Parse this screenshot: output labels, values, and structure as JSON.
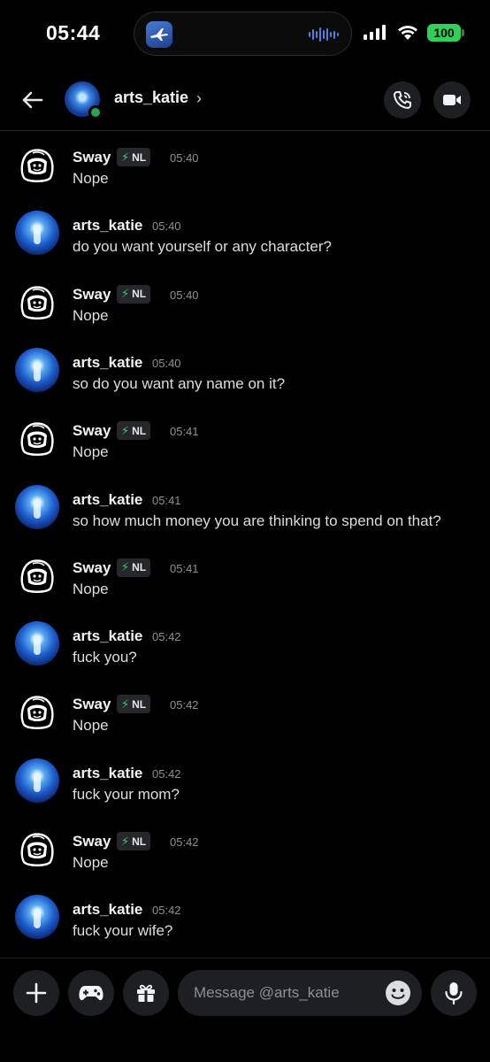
{
  "status_bar": {
    "time": "05:44",
    "battery": "100",
    "icons": [
      "airplane-app-icon",
      "audio-wave-icon",
      "signal-icon",
      "wifi-icon",
      "battery-icon"
    ]
  },
  "header": {
    "name": "arts_katie",
    "chevron": "›",
    "online_color": "#23a55a",
    "icons": [
      "back-arrow-icon",
      "voice-call-icon",
      "video-call-icon"
    ]
  },
  "messages": [
    {
      "author": "Sway",
      "tag": "NL",
      "time": "05:40",
      "text": "Nope",
      "avatar": "sway"
    },
    {
      "author": "arts_katie",
      "tag": "",
      "time": "05:40",
      "text": "do you want yourself or any character?",
      "avatar": "katie"
    },
    {
      "author": "Sway",
      "tag": "NL",
      "time": "05:40",
      "text": "Nope",
      "avatar": "sway"
    },
    {
      "author": "arts_katie",
      "tag": "",
      "time": "05:40",
      "text": "so do you want any name on it?",
      "avatar": "katie"
    },
    {
      "author": "Sway",
      "tag": "NL",
      "time": "05:41",
      "text": "Nope",
      "avatar": "sway"
    },
    {
      "author": "arts_katie",
      "tag": "",
      "time": "05:41",
      "text": "so how much money you are thinking to spend on that?",
      "avatar": "katie"
    },
    {
      "author": "Sway",
      "tag": "NL",
      "time": "05:41",
      "text": "Nope",
      "avatar": "sway"
    },
    {
      "author": "arts_katie",
      "tag": "",
      "time": "05:42",
      "text": "fuck you?",
      "avatar": "katie"
    },
    {
      "author": "Sway",
      "tag": "NL",
      "time": "05:42",
      "text": "Nope",
      "avatar": "sway"
    },
    {
      "author": "arts_katie",
      "tag": "",
      "time": "05:42",
      "text": "fuck your mom?",
      "avatar": "katie"
    },
    {
      "author": "Sway",
      "tag": "NL",
      "time": "05:42",
      "text": "Nope",
      "avatar": "sway"
    },
    {
      "author": "arts_katie",
      "tag": "",
      "time": "05:42",
      "text": "fuck your wife?",
      "avatar": "katie"
    }
  ],
  "composer": {
    "placeholder": "Message @arts_katie",
    "icons": [
      "plus-icon",
      "gamepad-icon",
      "gift-icon",
      "emoji-icon",
      "microphone-icon"
    ]
  },
  "colors": {
    "background": "#000000",
    "tag_bolt": "#3ec96e",
    "battery": "#30d158"
  }
}
